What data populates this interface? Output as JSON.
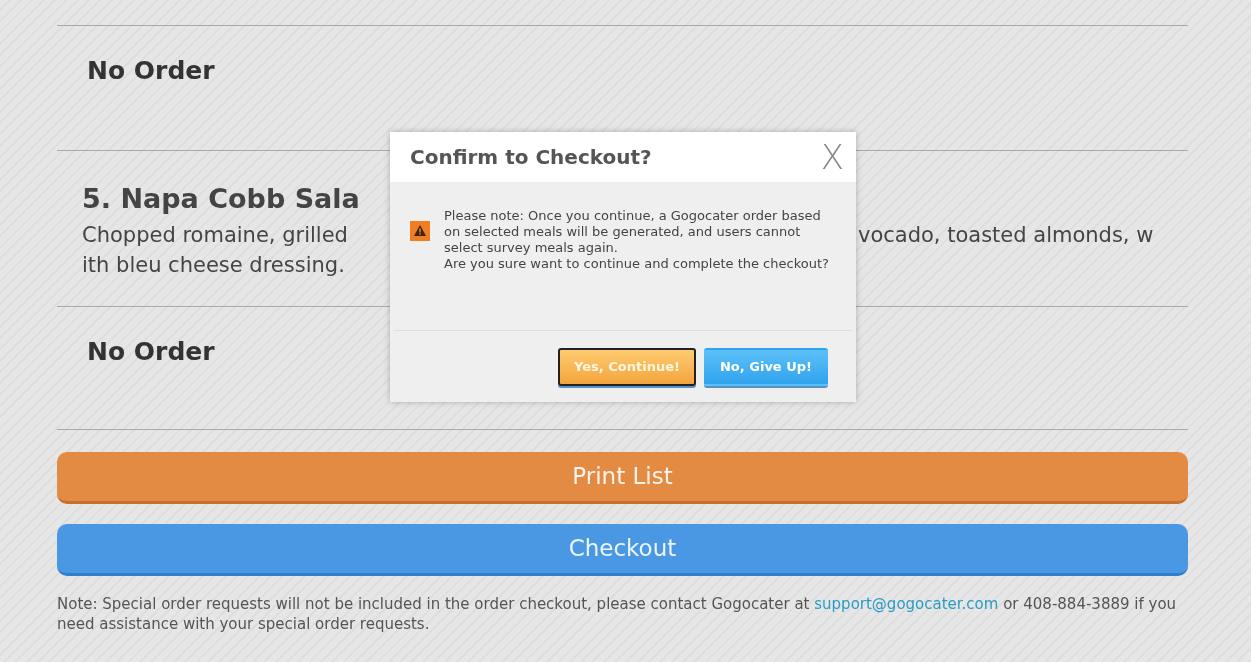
{
  "sections": [
    {
      "kind": "status",
      "text": "No Order"
    },
    {
      "kind": "dish",
      "title": "5. Napa Cobb Sala",
      "lines": [
        {
          "left": "Chopped romaine, grilled",
          "right": "vocado, toasted almonds, w"
        },
        {
          "left": "ith bleu cheese dressing."
        }
      ]
    },
    {
      "kind": "status",
      "text": "No Order"
    }
  ],
  "actions": [
    {
      "kind": "print",
      "label": "Print List"
    },
    {
      "kind": "checkout",
      "label": "Checkout"
    }
  ],
  "note": {
    "before": "Note: Special order requests will not be included in the order checkout, please contact Gogocater at ",
    "link": "support@gogocater.com",
    "after": " or 408-884-3889 if you need assistance with your special order requests."
  },
  "dialog": {
    "title": "Confirm to Checkout?",
    "close": "X",
    "message": "Please note: Once you continue, a Gogocater order based on selected meals will be generated, and users cannot select survey meals again.",
    "question": "Are you sure want to continue and complete the checkout?",
    "buttons": [
      {
        "kind": "confirm",
        "label": "Yes, Continue!",
        "focused": true
      },
      {
        "kind": "cancel",
        "label": "No, Give Up!",
        "focused": false
      }
    ]
  }
}
